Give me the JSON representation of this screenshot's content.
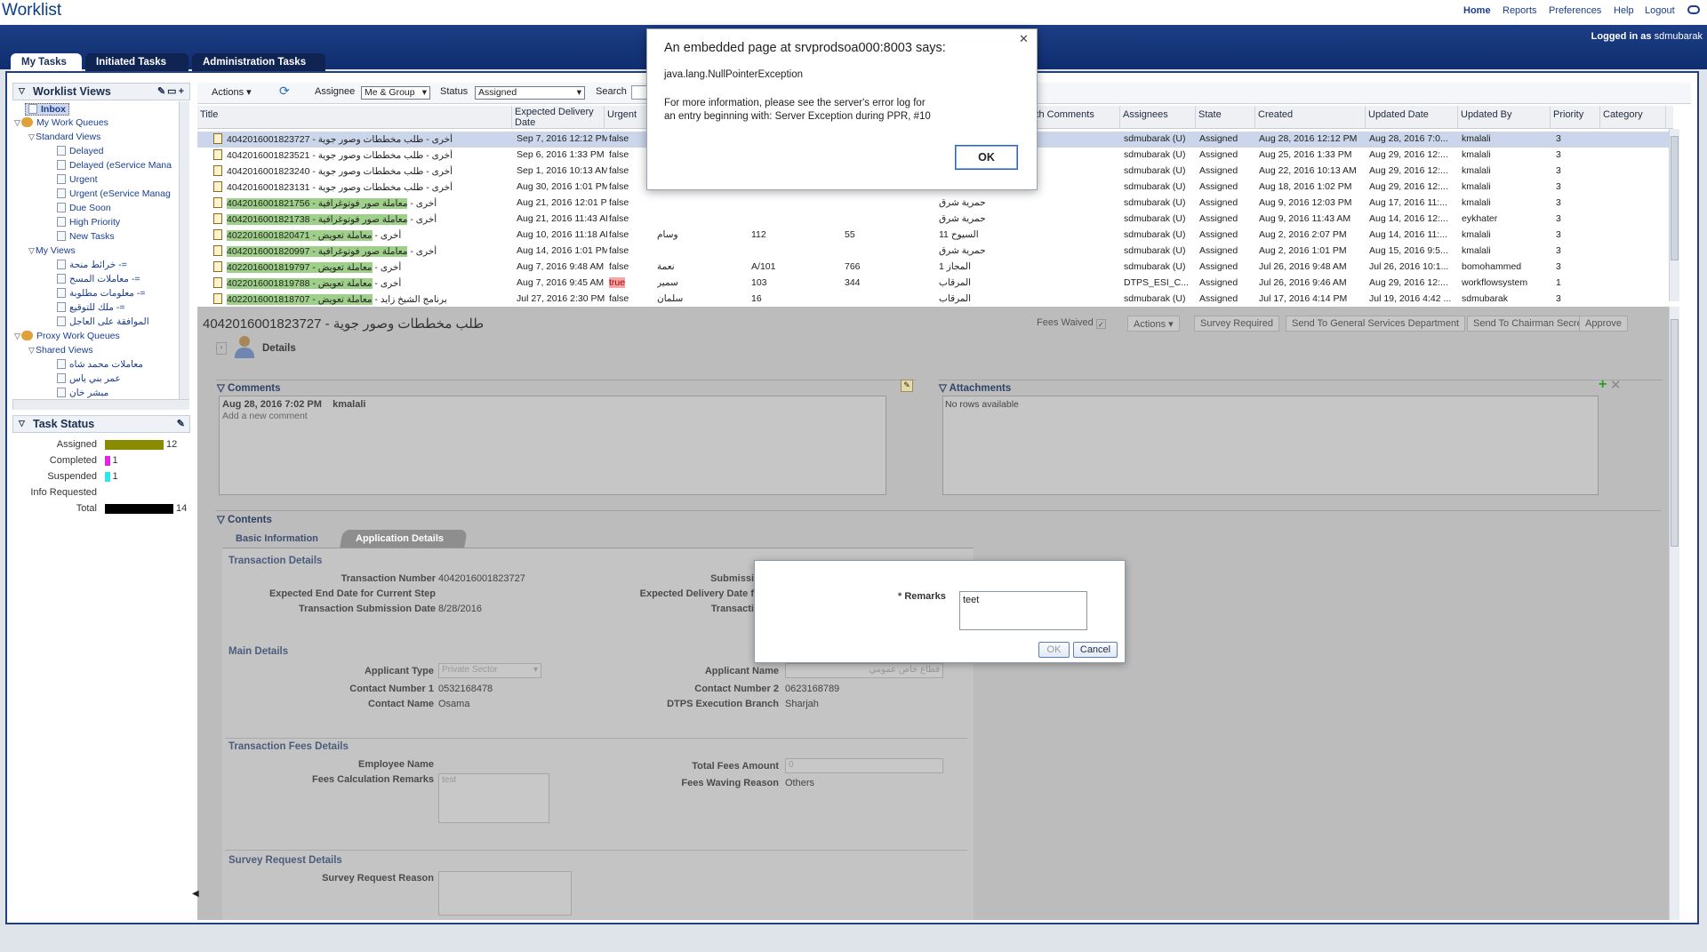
{
  "app": {
    "title": "Worklist"
  },
  "nav": {
    "home": "Home",
    "reports": "Reports",
    "preferences": "Preferences",
    "help": "Help",
    "logout": "Logout"
  },
  "user": {
    "prefix": "Logged in as",
    "name": "sdmubarak"
  },
  "tabs": [
    "My Tasks",
    "Initiated Tasks",
    "Administration Tasks"
  ],
  "sidebar": {
    "title": "Worklist Views",
    "inbox": "Inbox",
    "my_work_queues": "My Work Queues",
    "standard_views": "Standard Views",
    "standard_items": [
      "Delayed",
      "Delayed (eService Mana",
      "Urgent",
      "Urgent (eService Manag",
      "Due Soon",
      "High Priority",
      "New Tasks"
    ],
    "my_views": "My Views",
    "my_view_items": [
      "خرائط منحة -=",
      "معاملات المسح -=",
      "معلومات مطلوبة -=",
      "ملك للتوقيع -=",
      "الموافقة على العاجل"
    ],
    "proxy_work_queues": "Proxy Work Queues",
    "shared_views": "Shared Views",
    "shared_items": [
      "معاملات محمد شاه",
      "عمر بني ياس",
      "مبشر خان"
    ]
  },
  "task_status": {
    "title": "Task Status",
    "rows": [
      {
        "label": "Assigned",
        "count": "12",
        "value": 12,
        "color": "#8b8b00"
      },
      {
        "label": "Completed",
        "count": "1",
        "value": 1,
        "color": "#e820e8"
      },
      {
        "label": "Suspended",
        "count": "1",
        "value": 1,
        "color": "#28e8e8"
      },
      {
        "label": "Info Requested",
        "count": "",
        "value": 0,
        "color": "#000000"
      },
      {
        "label": "Total",
        "count": "14",
        "value": 14,
        "color": "#000000"
      }
    ]
  },
  "toolbar": {
    "actions": "Actions",
    "assignee_label": "Assignee",
    "assignee_value": "Me & Group",
    "status_label": "Status",
    "status_value": "Assigned",
    "search_label": "Search"
  },
  "table": {
    "headers": [
      "Title",
      "Expected Delivery Date",
      "Urgent",
      "",
      "",
      "",
      "ith Comments",
      "Assignees",
      "State",
      "Created",
      "Updated Date",
      "Updated By",
      "Priority",
      "Category"
    ],
    "rows": [
      {
        "title_prefix": "أخرى",
        "title_id": "4042016001823727",
        "title_text": "طلب مخططات وصور جوية",
        "hl": false,
        "exp": "Sep 7, 2016 12:12 PM",
        "urgent": "false",
        "c1": "",
        "c2": "",
        "c3": "",
        "c4": "",
        "assignee": "sdmubarak (U)",
        "state": "Assigned",
        "created": "Aug 28, 2016 12:12 PM",
        "updated": "Aug 28, 2016 7:0...",
        "by": "kmalali",
        "priority": "3"
      },
      {
        "title_prefix": "أخرى",
        "title_id": "4042016001823521",
        "title_text": "طلب مخططات وصور جوية",
        "hl": false,
        "exp": "Sep 6, 2016 1:33 PM",
        "urgent": "false",
        "c1": "",
        "c2": "",
        "c3": "",
        "c4": "",
        "assignee": "sdmubarak (U)",
        "state": "Assigned",
        "created": "Aug 25, 2016 1:33 PM",
        "updated": "Aug 29, 2016 12:...",
        "by": "kmalali",
        "priority": "3"
      },
      {
        "title_prefix": "أخرى",
        "title_id": "4042016001823240",
        "title_text": "طلب مخططات وصور جوية",
        "hl": false,
        "exp": "Sep 1, 2016 10:13 AM",
        "urgent": "false",
        "c1": "",
        "c2": "",
        "c3": "",
        "c4": "",
        "assignee": "sdmubarak (U)",
        "state": "Assigned",
        "created": "Aug 22, 2016 10:13 AM",
        "updated": "Aug 29, 2016 12:...",
        "by": "kmalali",
        "priority": "3"
      },
      {
        "title_prefix": "أخرى",
        "title_id": "4042016001823131",
        "title_text": "طلب مخططات وصور جوية",
        "hl": false,
        "exp": "Aug 30, 2016 1:01 PM",
        "urgent": "false",
        "c1": "",
        "c2": "",
        "c3": "",
        "c4": "",
        "assignee": "sdmubarak (U)",
        "state": "Assigned",
        "created": "Aug 18, 2016 1:02 PM",
        "updated": "Aug 29, 2016 12:...",
        "by": "kmalali",
        "priority": "3"
      },
      {
        "title_prefix": "أخرى",
        "title_id": "4042016001821756",
        "title_text": "معاملة صور فوتوغرافية",
        "hl": true,
        "exp": "Aug 21, 2016 12:01 PM",
        "urgent": "false",
        "c1": "",
        "c2": "",
        "c3": "",
        "c4": "حمرية شرق",
        "assignee": "sdmubarak (U)",
        "state": "Assigned",
        "created": "Aug 9, 2016 12:03 PM",
        "updated": "Aug 17, 2016 11:...",
        "by": "kmalali",
        "priority": "3"
      },
      {
        "title_prefix": "أخرى",
        "title_id": "4042016001821738",
        "title_text": "معاملة صور فوتوغرافية",
        "hl": true,
        "exp": "Aug 21, 2016 11:43 AM",
        "urgent": "false",
        "c1": "",
        "c2": "",
        "c3": "",
        "c4": "حمرية شرق",
        "assignee": "sdmubarak (U)",
        "state": "Assigned",
        "created": "Aug 9, 2016 11:43 AM",
        "updated": "Aug 14, 2016 12:...",
        "by": "eykhater",
        "priority": "3"
      },
      {
        "title_prefix": "أخرى",
        "title_id": "4022016001820471",
        "title_text": "معاملة تعويض",
        "hl": true,
        "exp": "Aug 10, 2016 11:18 AM",
        "urgent": "false",
        "c1": "وسام",
        "c2": "112",
        "c3": "55",
        "c4": "السيوح 11",
        "assignee": "sdmubarak (U)",
        "state": "Assigned",
        "created": "Aug 2, 2016 2:07 PM",
        "updated": "Aug 14, 2016 11:...",
        "by": "kmalali",
        "priority": "3"
      },
      {
        "title_prefix": "أخرى",
        "title_id": "4042016001820997",
        "title_text": "معاملة صور فوتوغرافية",
        "hl": true,
        "exp": "Aug 14, 2016 1:01 PM",
        "urgent": "false",
        "c1": "",
        "c2": "",
        "c3": "",
        "c4": "حمرية شرق",
        "assignee": "sdmubarak (U)",
        "state": "Assigned",
        "created": "Aug 2, 2016 1:01 PM",
        "updated": "Aug 15, 2016 9:5...",
        "by": "kmalali",
        "priority": "3"
      },
      {
        "title_prefix": "أخرى",
        "title_id": "4022016001819797",
        "title_text": "معاملة تعويض",
        "hl": true,
        "exp": "Aug 7, 2016 9:48 AM",
        "urgent": "false",
        "c1": "نعمة",
        "c2": "101/A",
        "c3": "766",
        "c4": "المجاز 1",
        "assignee": "sdmubarak (U)",
        "state": "Assigned",
        "created": "Jul 26, 2016 9:48 AM",
        "updated": "Jul 26, 2016 10:1...",
        "by": "bomohammed",
        "priority": "3"
      },
      {
        "title_prefix": "أخرى",
        "title_id": "4022016001819788",
        "title_text": "معاملة تعويض",
        "hl": true,
        "exp": "Aug 7, 2016 9:45 AM",
        "urgent": "true",
        "c1": "سمير",
        "c2": "103",
        "c3": "344",
        "c4": "المرقاب",
        "assignee": "DTPS_ESI_C...",
        "state": "Assigned",
        "created": "Jul 26, 2016 9:46 AM",
        "updated": "Aug 29, 2016 12:...",
        "by": "workflowsystem",
        "priority": "1"
      },
      {
        "title_prefix": "برنامج الشيخ زايد",
        "title_id": "4022016001818707",
        "title_text": "معاملة تعويض",
        "hl": true,
        "exp": "Jul 27, 2016 2:30 PM",
        "urgent": "false",
        "c1": "سلمان",
        "c2": "16",
        "c3": "",
        "c4": "المرقاب",
        "assignee": "sdmubarak (U)",
        "state": "Assigned",
        "created": "Jul 17, 2016 4:14 PM",
        "updated": "Jul 19, 2016 4:42 ...",
        "by": "sdmubarak",
        "priority": "3"
      }
    ]
  },
  "detail": {
    "title": "طلب مخططات وصور جوية - 4042016001823727",
    "fees_waived": "Fees Waived",
    "actions": "Actions",
    "buttons": [
      "Survey Required",
      "Send To General Services Department",
      "Send To Chairman Secretary",
      "Approve"
    ],
    "details_label": "Details",
    "comments_label": "Comments",
    "comment_date": "Aug 28, 2016 7:02 PM",
    "comment_user": "kmalali",
    "add_comment": "Add a new comment",
    "attachments_label": "Attachments",
    "no_rows": "No rows available",
    "contents_label": "Contents",
    "tab_basic": "Basic Information",
    "tab_app": "Application Details",
    "transaction_details": "Transaction Details",
    "transaction_number_label": "Transaction Number",
    "transaction_number": "4042016001823727",
    "expected_end_label": "Expected End Date for Current Step",
    "submission_date_label": "Transaction Submission Date",
    "submission_date": "8/28/2016",
    "submis_label": "Submissi",
    "expected_delivery_label": "Expected Delivery Date f",
    "transacti_label": "Transacti",
    "main_details": "Main Details",
    "applicant_type_label": "Applicant Type",
    "applicant_type": "Private Sector",
    "applicant_name_label": "Applicant Name",
    "applicant_name": "قطاع خاص عمومي",
    "contact1_label": "Contact Number 1",
    "contact1": "0532168478",
    "contact2_label": "Contact Number 2",
    "contact2": "0623168789",
    "contact_name_label": "Contact Name",
    "contact_name": "Osama",
    "branch_label": "DTPS Execution Branch",
    "branch": "Sharjah",
    "fees_details": "Transaction Fees Details",
    "employee_name_label": "Employee Name",
    "fees_remarks_label": "Fees Calculation Remarks",
    "fees_remarks": "test",
    "total_fees_label": "Total Fees Amount",
    "total_fees": "0",
    "waiving_reason_label": "Fees Waving Reason",
    "waiving_reason": "Others",
    "survey_details": "Survey Request Details",
    "survey_reason_label": "Survey Request Reason"
  },
  "alert": {
    "title": "An embedded page at srvprodsoa000:8003 says:",
    "line1": "java.lang.NullPointerException",
    "line2": "For more information, please see the server's error log for",
    "line3": "an entry beginning with: Server Exception during PPR, #10",
    "ok": "OK"
  },
  "remarks_dialog": {
    "label": "Remarks",
    "required": "*",
    "value": "teet",
    "ok": "OK",
    "cancel": "Cancel"
  }
}
